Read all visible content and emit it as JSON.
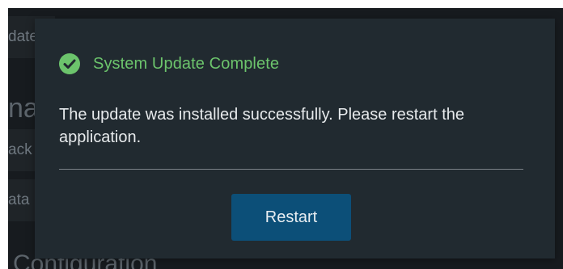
{
  "background": {
    "nav_items": [
      {
        "label": "date"
      },
      {
        "label": "ack"
      },
      {
        "label": "ata"
      }
    ],
    "heading_fragment": "nag",
    "footer_fragment": "Configuration"
  },
  "dialog": {
    "icon": "check-circle-icon",
    "title": "System Update Complete",
    "message": "The update was installed successfully. Please restart the application.",
    "restart_label": "Restart"
  },
  "colors": {
    "success": "#6cc46c",
    "button": "#0c4f78",
    "dialog_bg": "#212a30"
  }
}
